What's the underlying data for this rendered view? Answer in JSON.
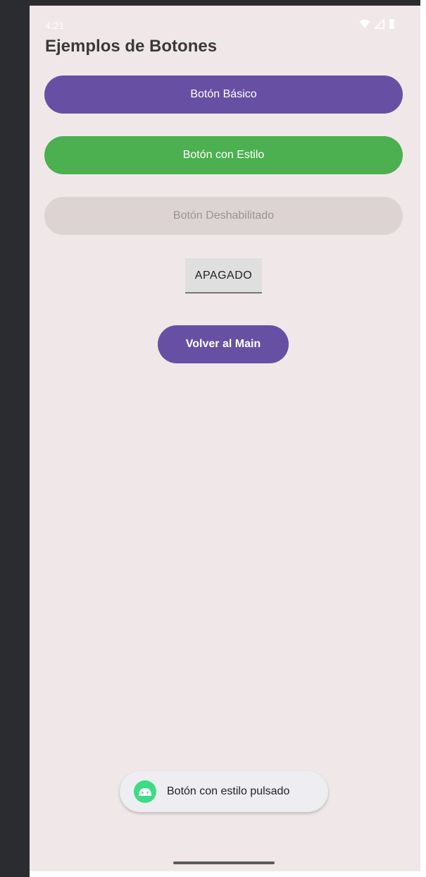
{
  "status_bar": {
    "time": "4:21",
    "icons": [
      "wifi-icon",
      "signal-icon",
      "battery-icon"
    ]
  },
  "screen": {
    "title": "Ejemplos de Botones"
  },
  "buttons": {
    "basic_label": "Botón Básico",
    "styled_label": "Botón con Estilo",
    "disabled_label": "Botón Deshabilitado",
    "toggle_label": "APAGADO",
    "back_label": "Volver al Main"
  },
  "toast": {
    "icon": "android-icon",
    "message": "Botón con estilo pulsado"
  },
  "colors": {
    "primary": "#6750a4",
    "success": "#4caf50",
    "disabled_bg": "#ddd3d3",
    "background": "#f0e8e8"
  }
}
